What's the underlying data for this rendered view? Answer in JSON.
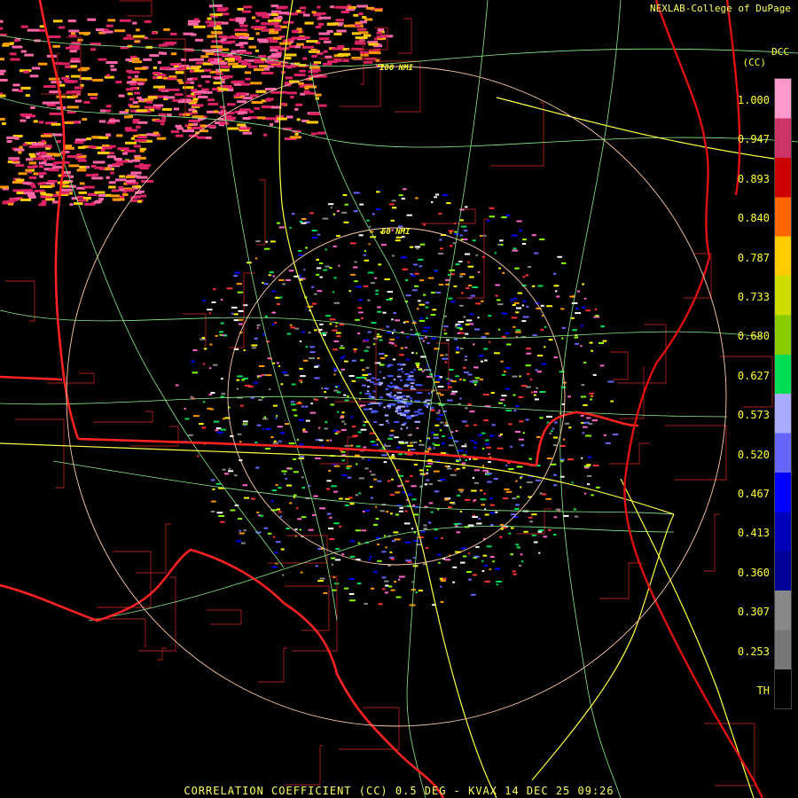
{
  "header": {
    "credit": "NEXLAB-College of DuPage",
    "product_code": "DCC",
    "product_unit": "(CC)"
  },
  "footer": {
    "caption": "CORRELATION COEFFICIENT (CC) 0.5 DEG - KVAX 14 DEC 25 09:26"
  },
  "range_rings": [
    "100 NMI",
    "50 NMI"
  ],
  "scale": {
    "labels": [
      "1.000",
      "0.947",
      "0.893",
      "0.840",
      "0.787",
      "0.733",
      "0.680",
      "0.627",
      "0.573",
      "0.520",
      "0.467",
      "0.413",
      "0.360",
      "0.307",
      "0.253",
      "TH"
    ],
    "colors": [
      "#ff99cc",
      "#cc3366",
      "#cc0000",
      "#ff6600",
      "#ffcc00",
      "#ccdd00",
      "#88cc00",
      "#00dd55",
      "#aaaaff",
      "#6666ff",
      "#0000ff",
      "#0000bb",
      "#000099",
      "#888888",
      "#777777",
      "#000000"
    ]
  },
  "map_colors": {
    "background": "#000000",
    "state_border": "#ff2222",
    "county_border": "#aa2020",
    "roads": "#88ee88",
    "interstate": "#ffff44",
    "coastline": "#dd1111",
    "range_ring": "#ffccaa"
  }
}
